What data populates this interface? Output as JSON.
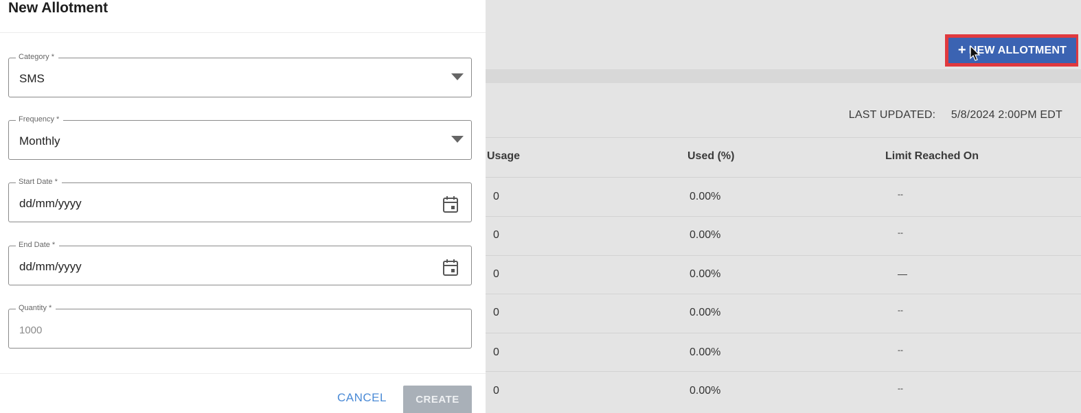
{
  "panel": {
    "title": "New Allotment",
    "fields": {
      "category": {
        "label": "Category *",
        "value": "SMS"
      },
      "frequency": {
        "label": "Frequency *",
        "value": "Monthly"
      },
      "start_date": {
        "label": "Start Date *",
        "value": "dd/mm/yyyy"
      },
      "end_date": {
        "label": "End Date *",
        "value": "dd/mm/yyyy"
      },
      "quantity": {
        "label": "Quantity *",
        "placeholder": "1000"
      }
    },
    "cancel_label": "CANCEL",
    "create_label": "CREATE"
  },
  "page": {
    "new_allotment_plus": "+",
    "new_allotment_label": "NEW ALLOTMENT",
    "last_updated_label": "LAST UPDATED:",
    "last_updated_value": "5/8/2024 2:00PM EDT",
    "table": {
      "headers": [
        "Usage",
        "Used (%)",
        "Limit Reached On"
      ],
      "rows": [
        [
          "0",
          "0.00%",
          "--"
        ],
        [
          "0",
          "0.00%",
          "--"
        ],
        [
          "0",
          "0.00%",
          "—"
        ],
        [
          "0",
          "0.00%",
          "--"
        ],
        [
          "0",
          "0.00%",
          "--"
        ],
        [
          "0",
          "0.00%",
          "--"
        ]
      ]
    }
  },
  "icons": {
    "dropdown": "triangle-down",
    "calendar": "calendar",
    "cursor": "mouse-pointer"
  },
  "colors": {
    "primary_button": "#3b63b2",
    "highlight": "#e0393e",
    "link": "#4a8ad6",
    "disabled_button": "#a9b0b8"
  }
}
